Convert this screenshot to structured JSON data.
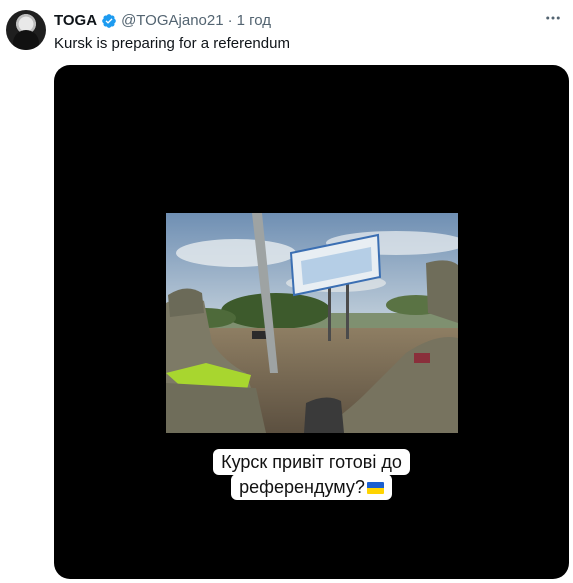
{
  "tweet": {
    "display_name": "TOGA",
    "handle": "@TOGAjano21",
    "separator": "·",
    "time": "1 год",
    "text": "Kursk is preparing for a referendum",
    "more_icon": "more-horizontal-icon",
    "verified_color": "#1d9bf0"
  },
  "media": {
    "caption_line1": "Курск привіт готові до",
    "caption_line2": "референдуму?",
    "caption_emoji": "ukraine-flag-icon",
    "background": "#000000"
  }
}
